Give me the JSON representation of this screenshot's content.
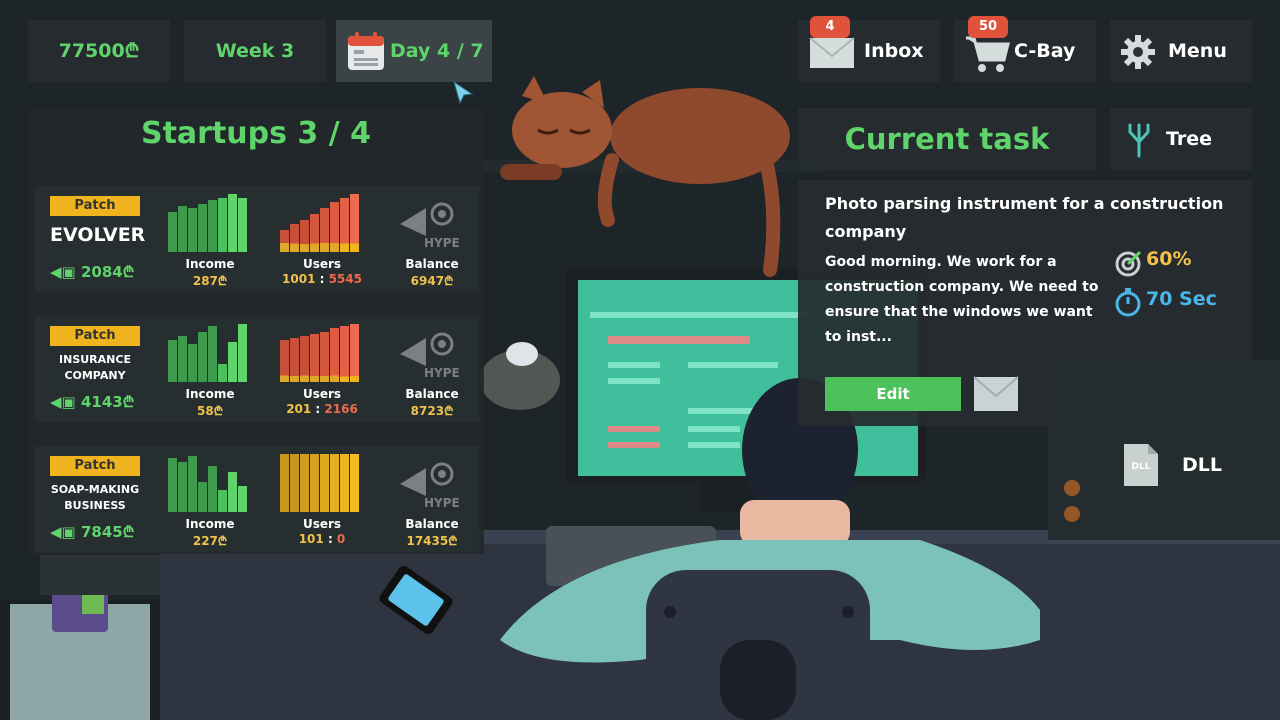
{
  "topbar": {
    "money": "77500₾",
    "week": "Week 3",
    "day": "Day 4 / 7",
    "inbox": {
      "label": "Inbox",
      "badge": "4"
    },
    "cbay": {
      "label": "C-Bay",
      "badge": "50"
    },
    "menu": {
      "label": "Menu"
    }
  },
  "startups": {
    "title": "Startups 3 / 4",
    "items": [
      {
        "tag": "Patch",
        "name": "EVOLVER",
        "cost": "2084₾",
        "income_label": "Income",
        "income": "287₾",
        "users_label": "Users",
        "users_a": "1001",
        "users_sep": " : ",
        "users_b": "5545",
        "hype_label": "HYPE",
        "balance_label": "Balance",
        "balance": "6947₾"
      },
      {
        "tag": "Patch",
        "name": "INSURANCE COMPANY",
        "cost": "4143₾",
        "income_label": "Income",
        "income": "58₾",
        "users_label": "Users",
        "users_a": "201",
        "users_sep": " : ",
        "users_b": "2166",
        "hype_label": "HYPE",
        "balance_label": "Balance",
        "balance": "8723₾"
      },
      {
        "tag": "Patch",
        "name": "SOAP-MAKING BUSINESS",
        "cost": "7845₾",
        "income_label": "Income",
        "income": "227₾",
        "users_label": "Users",
        "users_a": "101",
        "users_sep": " : ",
        "users_b": "0",
        "hype_label": "HYPE",
        "balance_label": "Balance",
        "balance": "17435₾"
      }
    ]
  },
  "task": {
    "header": "Current task",
    "title": "Photo parsing instrument for a construction company",
    "body": "Good morning. We work for a construction company. We need to ensure that the windows we want to inst...",
    "progress": "60%",
    "time": "70 Sec",
    "edit_label": "Edit"
  },
  "side": {
    "tree_label": "Tree",
    "dll_label": "DLL",
    "dll_file": "DLL"
  },
  "colors": {
    "accent_green": "#5fd46b",
    "gold": "#f0c24a",
    "red_badge": "#e0523a",
    "patch": "#f0b41e",
    "timer_blue": "#4ab6e8"
  }
}
